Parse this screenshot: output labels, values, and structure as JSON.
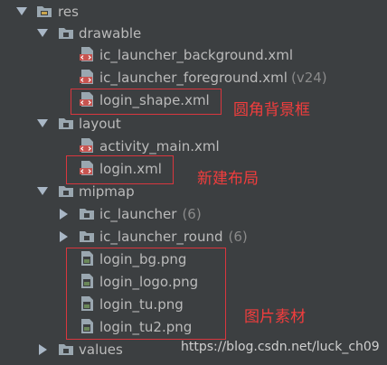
{
  "tree": {
    "res": "res",
    "drawable": "drawable",
    "ic_launcher_background": "ic_launcher_background.xml",
    "ic_launcher_foreground": "ic_launcher_foreground.xml",
    "ic_launcher_foreground_qualifier": "(v24)",
    "login_shape": "login_shape.xml",
    "layout": "layout",
    "activity_main": "activity_main.xml",
    "login_xml": "login.xml",
    "mipmap": "mipmap",
    "ic_launcher": "ic_launcher",
    "ic_launcher_count": "(6)",
    "ic_launcher_round": "ic_launcher_round",
    "ic_launcher_round_count": "(6)",
    "login_bg": "login_bg.png",
    "login_logo": "login_logo.png",
    "login_tu": "login_tu.png",
    "login_tu2": "login_tu2.png",
    "values": "values"
  },
  "annotations": {
    "rounded_bg": "圆角背景框",
    "new_layout": "新建布局",
    "image_assets": "图片素材"
  },
  "watermark": "https://blog.csdn.net/luck_ch09",
  "colors": {
    "background": "#3c3f41",
    "text": "#bbbbbb",
    "annotation_red": "#f23d3d",
    "folder": "#9aa7b0",
    "xml_icon": "#c75450"
  }
}
